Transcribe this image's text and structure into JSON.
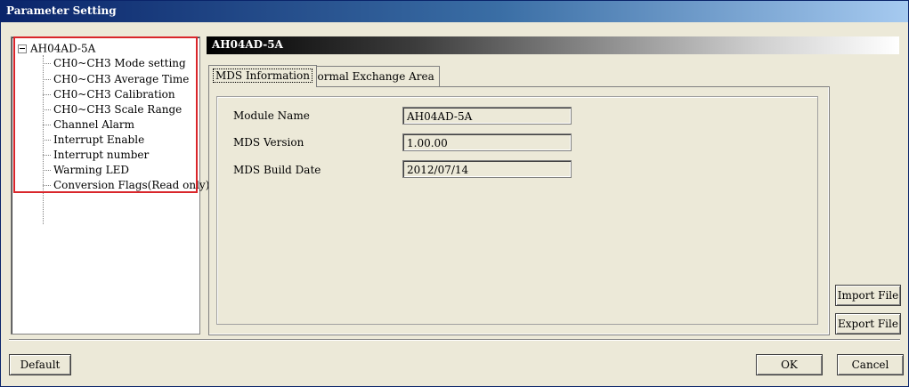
{
  "window": {
    "title": "Parameter Setting"
  },
  "tree": {
    "root": "AH04AD-5A",
    "items": [
      "CH0~CH3 Mode setting",
      "CH0~CH3 Average Time",
      "CH0~CH3 Calibration",
      "CH0~CH3 Scale Range",
      "Channel Alarm",
      "Interrupt Enable",
      "Interrupt number",
      "Warming LED",
      "Conversion Flags(Read only)"
    ]
  },
  "header": {
    "title": "AH04AD-5A"
  },
  "tabs": [
    {
      "label": "MDS Information",
      "active": true
    },
    {
      "label": "Normal Exchange Area",
      "active": false
    }
  ],
  "info": {
    "module_name_label": "Module Name",
    "module_name_value": "AH04AD-5A",
    "mds_version_label": "MDS Version",
    "mds_version_value": "1.00.00",
    "mds_build_date_label": "MDS Build Date",
    "mds_build_date_value": "2012/07/14"
  },
  "buttons": {
    "import": "Import File",
    "export": "Export File",
    "default": "Default",
    "ok": "OK",
    "cancel": "Cancel"
  },
  "colors": {
    "titlebar": "#0a246a",
    "highlight": "#d9262b",
    "background": "#ece9d8"
  }
}
